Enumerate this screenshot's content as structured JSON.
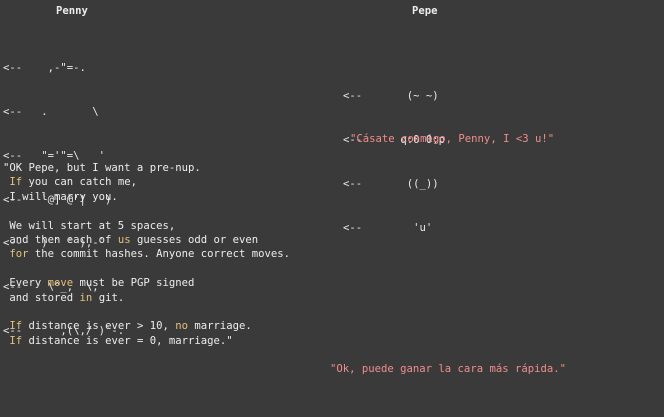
{
  "window": {
    "background": "#3a3a3a"
  },
  "speakers": {
    "left_name": "Penny",
    "right_name": "Pepe"
  },
  "penny_ascii": [
    "<--    ,-\"=-.",
    "<--   .       \\",
    "<--   \"='\"=\\   '",
    "<--   `@] @'|   )",
    "<--   ) ` ' ),-`",
    "<--    \\^_,  \\,",
    "<--      ,(\\,/ )`-."
  ],
  "pepe_ascii": [
    "<--       (~ ~)",
    "<--      q:0 0:p",
    "<--       ((_))",
    "<--        'u'"
  ],
  "pepe_quote": "\"Cásate conmigo, Penny, I <3 u!\"",
  "penny_reply": {
    "lines": [
      [
        {
          "t": "\"OK Pepe, but I want a pre-nup."
        }
      ],
      [
        {
          "t": " "
        },
        {
          "t": "If",
          "k": true
        },
        {
          "t": " you can catch me,"
        }
      ],
      [
        {
          "t": " I will marry you."
        }
      ],
      [
        {
          "t": ""
        }
      ],
      [
        {
          "t": " We will start at 5 spaces,"
        }
      ],
      [
        {
          "t": " and then each of "
        },
        {
          "t": "us",
          "k": true
        },
        {
          "t": " guesses odd or even"
        }
      ],
      [
        {
          "t": " "
        },
        {
          "t": "for",
          "k": true
        },
        {
          "t": " the commit hashes. Anyone correct moves."
        }
      ],
      [
        {
          "t": ""
        }
      ],
      [
        {
          "t": " Every "
        },
        {
          "t": "move",
          "k": true
        },
        {
          "t": " must be PGP signed"
        }
      ],
      [
        {
          "t": " and stored "
        },
        {
          "t": "in",
          "k": true
        },
        {
          "t": " git."
        }
      ],
      [
        {
          "t": ""
        }
      ],
      [
        {
          "t": " "
        },
        {
          "t": "If",
          "k": true
        },
        {
          "t": " distance is ever > 10, "
        },
        {
          "t": "no",
          "k": true
        },
        {
          "t": " marriage."
        }
      ],
      [
        {
          "t": " "
        },
        {
          "t": "If",
          "k": true
        },
        {
          "t": " distance is ever = 0, marriage.\""
        }
      ]
    ]
  },
  "pepe_final": "\"Ok, puede ganar la cara más rápida.\"",
  "colors": {
    "text": "#ececec",
    "keyword": "#e5c07b",
    "spanish": "#f08d8d"
  }
}
